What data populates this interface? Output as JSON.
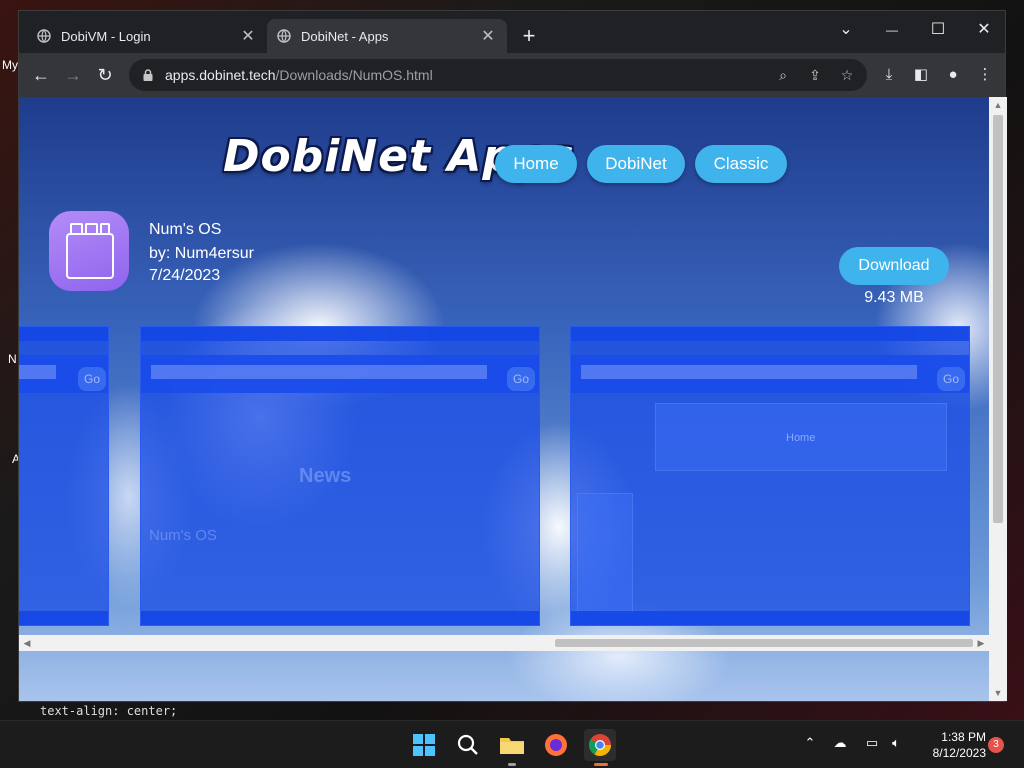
{
  "desktop": {
    "fragments": [
      "My",
      "N",
      "A",
      "A"
    ]
  },
  "browser": {
    "tabs": [
      {
        "title": "DobiVM - Login",
        "active": false
      },
      {
        "title": "DobiNet - Apps",
        "active": true
      }
    ],
    "newtab_label": "+",
    "window_controls": {
      "dropdown": "⌄",
      "minimize": "—",
      "maximize": "☐",
      "close": "✕"
    },
    "url_host": "apps.dobinet.tech",
    "url_path": "/Downloads/NumOS.html"
  },
  "site": {
    "logo": "DobiNet Apps",
    "nav": [
      "Home",
      "DobiNet",
      "Classic"
    ],
    "app": {
      "name": "Num's OS",
      "author": "by: Num4ersur",
      "date": "7/24/2023",
      "download_label": "Download",
      "size": "9.43 MB"
    },
    "screenshots": {
      "go_label": "Go",
      "shot2_text_a": "News",
      "shot2_text_b": "Num's OS",
      "shot3_panel": "Home"
    }
  },
  "editor_peek": "text-align: center;",
  "taskbar": {
    "time": "1:38 PM",
    "date": "8/12/2023",
    "notifications": "3"
  },
  "colors": {
    "accent": "#3fb3ec",
    "chrome_bg": "#202124",
    "toolbar_bg": "#35363a"
  }
}
